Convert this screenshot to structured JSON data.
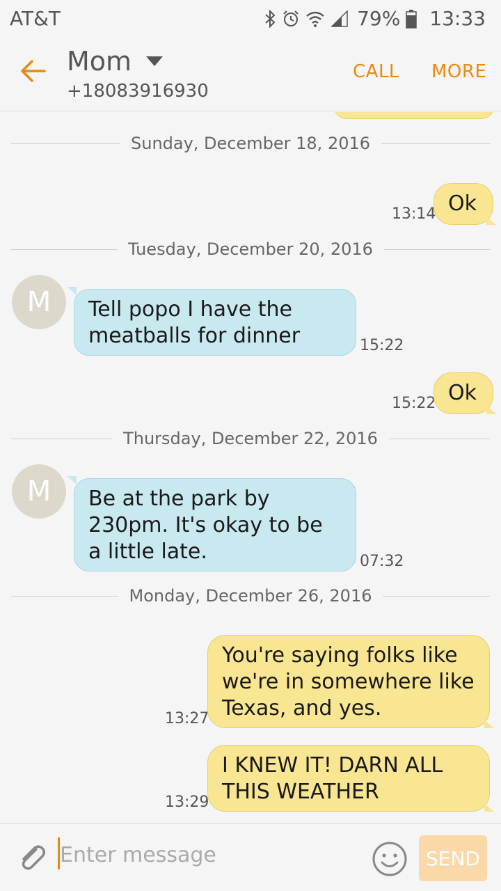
{
  "status_bar": {
    "carrier": "AT&T",
    "battery": "79%",
    "time": "13:33",
    "icons": [
      "bluetooth-icon",
      "alarm-icon",
      "wifi-icon",
      "signal-icon",
      "battery-icon"
    ]
  },
  "header": {
    "contact_name": "Mom",
    "contact_number": "+18083916930",
    "call_label": "CALL",
    "more_label": "MORE",
    "accent_color": "#e88a0e"
  },
  "messages": {
    "dates": [
      "Sunday, December 18, 2016",
      "Tuesday, December 20, 2016",
      "Thursday, December 22, 2016",
      "Monday, December 26, 2016"
    ],
    "items": [
      {
        "direction": "out",
        "text": "Ok",
        "time": "13:14"
      },
      {
        "direction": "in",
        "avatar": "M",
        "text": "Tell popo I have the meatballs for dinner",
        "time": "15:22"
      },
      {
        "direction": "out",
        "text": "Ok",
        "time": "15:22"
      },
      {
        "direction": "in",
        "avatar": "M",
        "text": "Be at the park by 230pm. It's okay to be a little late.",
        "time": "07:32"
      },
      {
        "direction": "out",
        "text": "You're saying folks like we're in somewhere like Texas, and yes.",
        "time": "13:27"
      },
      {
        "direction": "out",
        "text": "I KNEW IT!  DARN ALL THIS WEATHER",
        "time": "13:29"
      }
    ]
  },
  "compose": {
    "placeholder": "Enter message",
    "send_label": "SEND"
  }
}
